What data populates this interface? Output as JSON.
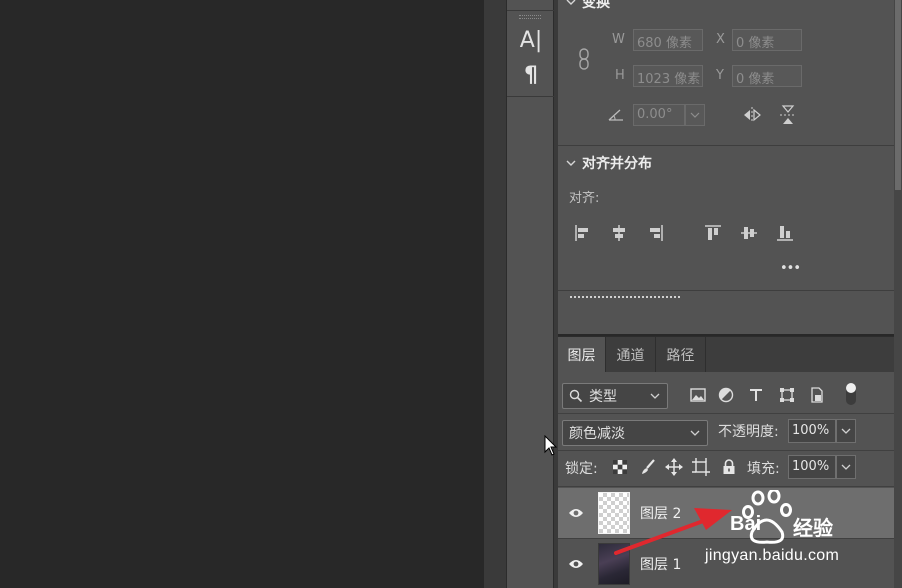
{
  "tools": {
    "type_tool": "A|",
    "paragraph_tool": "¶"
  },
  "properties": {
    "transform_title": "变换",
    "w_label": "W",
    "w_value": "680 像素",
    "x_label": "X",
    "x_value": "0 像素",
    "h_label": "H",
    "h_value": "1023 像素",
    "y_label": "Y",
    "y_value": "0 像素",
    "angle_value": "0.00°",
    "align_section_title": "对齐并分布",
    "align_label": "对齐:",
    "more_label": "•••"
  },
  "layers_panel": {
    "tabs": [
      "图层",
      "通道",
      "路径"
    ],
    "filter_kind": "类型",
    "blend_mode": "颜色减淡",
    "opacity_label": "不透明度:",
    "opacity_value": "100%",
    "lock_label": "锁定:",
    "fill_label": "填充:",
    "fill_value": "100%",
    "layers": [
      {
        "name": "图层 2",
        "selected": true
      },
      {
        "name": "图层 1",
        "selected": false
      }
    ]
  },
  "watermark": {
    "brand": "经验",
    "url": "jingyan.baidu.com"
  },
  "colors": {
    "panel": "#535353",
    "canvas": "#282828",
    "accent_arrow": "#e0282e"
  }
}
